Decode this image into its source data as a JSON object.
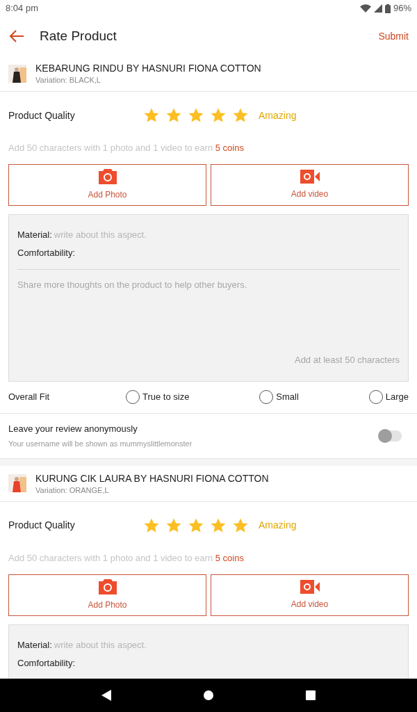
{
  "status_bar": {
    "time": "8:04 pm",
    "battery": "96%"
  },
  "header": {
    "title": "Rate Product",
    "action": "Submit"
  },
  "products": [
    {
      "name": "KEBARUNG RINDU BY HASNURI FIONA COTTON",
      "variation": "Variation: BLACK,L",
      "quality_label": "Product Quality",
      "stars": 5,
      "rating_text": "Amazing",
      "hint": "Add 50 characters with 1 photo and 1 video to earn",
      "coins": "5 coins",
      "photo_button": "Add Photo",
      "video_button": "Add video",
      "aspects": [
        {
          "label": "Material:",
          "placeholder": "write about this aspect."
        },
        {
          "label": "Comfortability:"
        }
      ],
      "thoughts_placeholder": "Share more thoughts on the product to help other buyers.",
      "min_hint": "Add at least 50 characters",
      "fit": {
        "label": "Overall Fit",
        "options": [
          {
            "label": "True to size",
            "selected": false
          },
          {
            "label": "Small",
            "selected": false
          },
          {
            "label": "Large",
            "selected": false
          }
        ]
      },
      "anonymous": {
        "label": "Leave your review anonymously",
        "note": "Your username will be shown as mummyslittlemonster",
        "on": false
      }
    },
    {
      "name": "KURUNG CIK LAURA BY HASNURI FIONA COTTON",
      "variation": "Variation: ORANGE,L",
      "quality_label": "Product Quality",
      "stars": 5,
      "rating_text": "Amazing",
      "hint": "Add 50 characters with 1 photo and 1 video to earn",
      "coins": "5 coins",
      "photo_button": "Add Photo",
      "video_button": "Add video",
      "aspects": [
        {
          "label": "Material:",
          "placeholder": "write about this aspect."
        },
        {
          "label": "Comfortability:"
        }
      ]
    }
  ]
}
